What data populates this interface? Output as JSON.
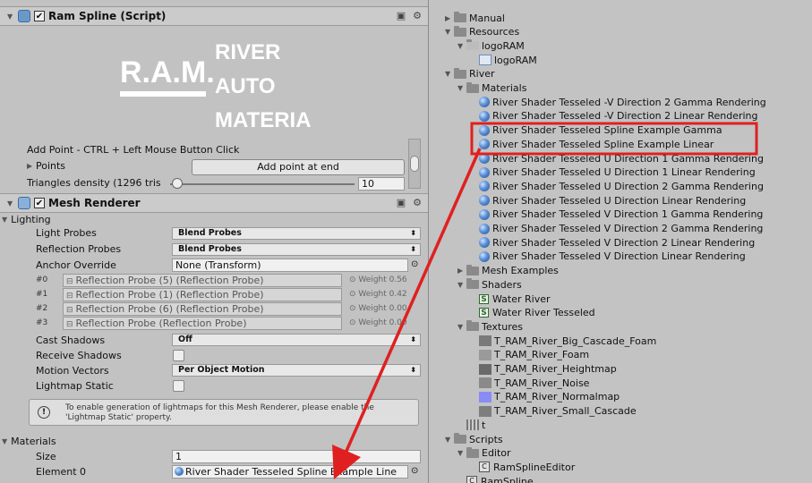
{
  "inspector": {
    "ram_spline": {
      "title": "Ram Spline (Script)",
      "logo": {
        "left_text": "R.A.M.",
        "right_line1": "RIVER",
        "right_line2": "AUTO",
        "right_line3": "MATERIAL"
      },
      "add_point_hint": "Add Point  - CTRL + Left Mouse Button Click",
      "points_label": "Points",
      "add_point_button": "Add point at end",
      "triangles_label": "Triangles density (1296 tris",
      "triangles_value": "10",
      "slider_fraction": 0.04
    },
    "mesh_renderer": {
      "title": "Mesh Renderer",
      "lighting_label": "Lighting",
      "light_probes_label": "Light Probes",
      "light_probes_value": "Blend Probes",
      "reflection_probes_label": "Reflection Probes",
      "reflection_probes_value": "Blend Probes",
      "anchor_override_label": "Anchor Override",
      "anchor_override_value": "None (Transform)",
      "probes": [
        {
          "index": "#0",
          "name": "Reflection Probe (5) (Reflection Probe)",
          "weight": "Weight 0.56"
        },
        {
          "index": "#1",
          "name": "Reflection Probe (1) (Reflection Probe)",
          "weight": "Weight 0.42"
        },
        {
          "index": "#2",
          "name": "Reflection Probe (6) (Reflection Probe)",
          "weight": "Weight 0.00"
        },
        {
          "index": "#3",
          "name": "Reflection Probe (Reflection Probe)",
          "weight": "Weight 0.00"
        }
      ],
      "cast_shadows_label": "Cast Shadows",
      "cast_shadows_value": "Off",
      "receive_shadows_label": "Receive Shadows",
      "motion_vectors_label": "Motion Vectors",
      "motion_vectors_value": "Per Object Motion",
      "lightmap_static_label": "Lightmap Static",
      "help_line1": "To enable generation of lightmaps for this Mesh Renderer, please enable the",
      "help_line2": "'Lightmap Static' property.",
      "materials_label": "Materials",
      "size_label": "Size",
      "size_value": "1",
      "element0_label": "Element 0",
      "element0_value": "River Shader Tesseled Spline Example Line"
    }
  },
  "project": {
    "items": [
      {
        "label": "Manual",
        "kind": "folder",
        "indent": 0,
        "expanded": false
      },
      {
        "label": "Resources",
        "kind": "folder",
        "indent": 0,
        "expanded": true
      },
      {
        "label": "logoRAM",
        "kind": "logo-folder",
        "indent": 1,
        "expanded": true
      },
      {
        "label": "logoRAM",
        "kind": "image",
        "indent": 2
      },
      {
        "label": "River",
        "kind": "folder",
        "indent": 0,
        "expanded": true
      },
      {
        "label": "Materials",
        "kind": "folder",
        "indent": 1,
        "expanded": true
      },
      {
        "label": "River Shader Tesseled -V Direction 2 Gamma Rendering",
        "kind": "material",
        "indent": 2
      },
      {
        "label": "River Shader Tesseled -V Direction 2 Linear Rendering",
        "kind": "material",
        "indent": 2
      },
      {
        "label": "River Shader Tesseled Spline Example Gamma",
        "kind": "material",
        "indent": 2
      },
      {
        "label": "River Shader Tesseled Spline Example Linear",
        "kind": "material",
        "indent": 2
      },
      {
        "label": "River Shader Tesseled U Direction 1 Gamma Rendering",
        "kind": "material",
        "indent": 2
      },
      {
        "label": "River Shader Tesseled U Direction 1 Linear Rendering",
        "kind": "material",
        "indent": 2
      },
      {
        "label": "River Shader Tesseled U Direction 2 Gamma Rendering",
        "kind": "material",
        "indent": 2
      },
      {
        "label": "River Shader Tesseled U Direction Linear Rendering",
        "kind": "material",
        "indent": 2
      },
      {
        "label": "River Shader Tesseled V Direction 1 Gamma Rendering",
        "kind": "material",
        "indent": 2
      },
      {
        "label": "River Shader Tesseled V Direction 2 Gamma Rendering",
        "kind": "material",
        "indent": 2
      },
      {
        "label": "River Shader Tesseled V Direction 2 Linear Rendering",
        "kind": "material",
        "indent": 2
      },
      {
        "label": "River Shader Tesseled V Direction Linear Rendering",
        "kind": "material",
        "indent": 2
      },
      {
        "label": "Mesh Examples",
        "kind": "folder",
        "indent": 1,
        "expanded": false
      },
      {
        "label": "Shaders",
        "kind": "folder",
        "indent": 1,
        "expanded": true
      },
      {
        "label": "Water River",
        "kind": "shader",
        "indent": 2
      },
      {
        "label": "Water River Tesseled",
        "kind": "shader",
        "indent": 2
      },
      {
        "label": "Textures",
        "kind": "folder",
        "indent": 1,
        "expanded": true
      },
      {
        "label": "T_RAM_River_Big_Cascade_Foam",
        "kind": "texture",
        "indent": 2,
        "color": "#7a7a7a"
      },
      {
        "label": "T_RAM_River_Foam",
        "kind": "texture",
        "indent": 2,
        "color": "#9a9a9a"
      },
      {
        "label": "T_RAM_River_Heightmap",
        "kind": "texture",
        "indent": 2,
        "color": "#6a6a6a"
      },
      {
        "label": "T_RAM_River_Noise",
        "kind": "texture",
        "indent": 2,
        "color": "#8a8a8a"
      },
      {
        "label": "T_RAM_River_Normalmap",
        "kind": "texture",
        "indent": 2,
        "color": "#8a8cf5"
      },
      {
        "label": "T_RAM_River_Small_Cascade",
        "kind": "texture",
        "indent": 2,
        "color": "#7e7e7e"
      },
      {
        "label": "t",
        "kind": "mesh",
        "indent": 1
      },
      {
        "label": "Scripts",
        "kind": "folder",
        "indent": 0,
        "expanded": true
      },
      {
        "label": "Editor",
        "kind": "folder",
        "indent": 1,
        "expanded": true
      },
      {
        "label": "RamSplineEditor",
        "kind": "script",
        "indent": 2
      },
      {
        "label": "RamSpline",
        "kind": "script",
        "indent": 1
      }
    ]
  },
  "colors": {
    "highlight": "#e02020",
    "arrow": "#e02020"
  }
}
